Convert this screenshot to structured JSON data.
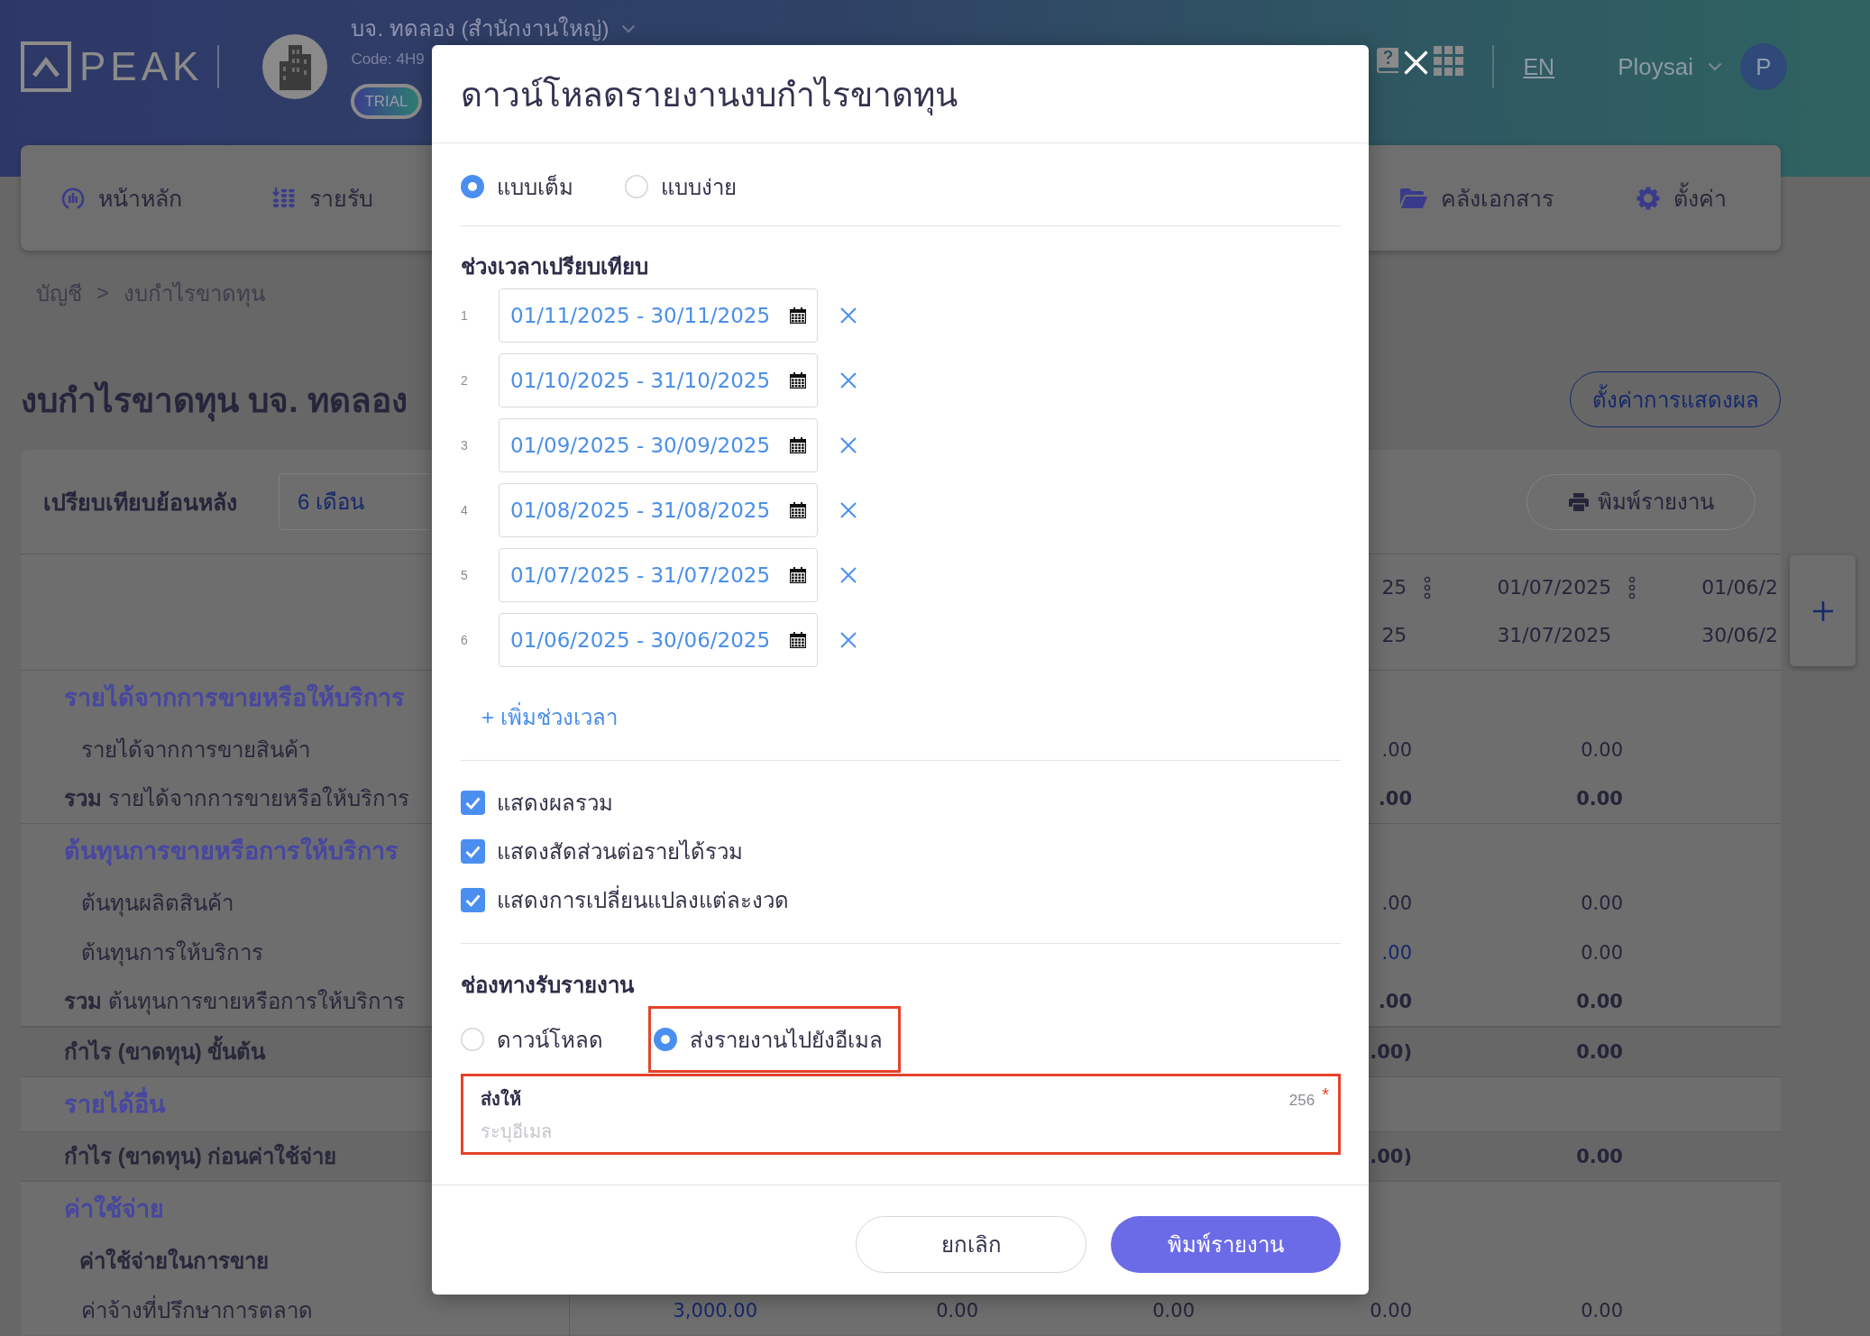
{
  "header": {
    "logo": "PEAK",
    "company": {
      "name": "บจ. ทดลอง (สำนักงานใหญ่)",
      "code": "Code: 4H9",
      "badge": "TRIAL"
    },
    "language": "EN",
    "user": {
      "name": "Ploysai",
      "initial": "P"
    }
  },
  "nav": [
    {
      "kind": "dashboard",
      "label": "หน้าหลัก"
    },
    {
      "kind": "income",
      "label": "รายรับ"
    },
    {
      "kind": "documents",
      "label": "คลังเอกสาร"
    },
    {
      "kind": "settings",
      "label": "ตั้งค่า"
    }
  ],
  "breadcrumb": [
    "บัญชี",
    ">",
    "งบกำไรขาดทุน"
  ],
  "page": {
    "title": "งบกำไรขาดทุน บจ. ทดลอง",
    "display_settings_button": "ตั้งค่าการแสดงผล"
  },
  "report": {
    "compare_label": "เปรียบเทียบย้อนหลัง",
    "period_select": "6 เดือน",
    "print_button": "พิมพ์รายงาน",
    "columns": [
      {
        "start": "25",
        "end": "25",
        "menu": true
      },
      {
        "start": "01/07/2025",
        "end": "31/07/2025",
        "menu": true
      },
      {
        "start": "01/06/2",
        "end": "30/06/2",
        "menu": false
      }
    ],
    "rows": [
      {
        "kind": "section",
        "label": "รายได้จากการขายหรือให้บริการ"
      },
      {
        "kind": "item",
        "label": "รายได้จากการขายสินค้า",
        "values": [
          {
            "text": ".00",
            "link": false
          },
          {
            "text": "0.00",
            "link": false
          }
        ]
      },
      {
        "kind": "total",
        "label": "**รวม** รายได้จากการขายหรือให้บริการ",
        "values": [
          {
            "text": ".00",
            "link": false
          },
          {
            "text": "0.00",
            "link": false
          }
        ]
      },
      {
        "kind": "section",
        "label": "ต้นทุนการขายหรือการให้บริการ"
      },
      {
        "kind": "item",
        "label": "ต้นทุนผลิตสินค้า",
        "values": [
          {
            "text": ".00",
            "link": false
          },
          {
            "text": "0.00",
            "link": false
          }
        ]
      },
      {
        "kind": "item",
        "label": "ต้นทุนการให้บริการ",
        "values": [
          {
            "text": ".00",
            "link": true
          },
          {
            "text": "0.00",
            "link": false
          }
        ]
      },
      {
        "kind": "total",
        "label": "**รวม** ต้นทุนการขายหรือการให้บริการ",
        "values": [
          {
            "text": ".00",
            "link": false
          },
          {
            "text": "0.00",
            "link": false
          }
        ]
      },
      {
        "kind": "band",
        "label": "กำไร (ขาดทุน) ขั้นต้น",
        "values": [
          {
            "text": ".00)",
            "link": false
          },
          {
            "text": "0.00",
            "link": false
          }
        ]
      },
      {
        "kind": "section",
        "label": "รายได้อื่น"
      },
      {
        "kind": "band",
        "label": "กำไร (ขาดทุน) ก่อนค่าใช้จ่าย",
        "values": [
          {
            "text": ".00)",
            "link": false
          },
          {
            "text": "0.00",
            "link": false
          }
        ]
      },
      {
        "kind": "section",
        "label": "ค่าใช้จ่าย"
      },
      {
        "kind": "group",
        "label": "ค่าใช้จ่ายในการขาย"
      },
      {
        "kind": "item",
        "label": "ค่าจ้างที่ปรึกษาการตลาด",
        "values": [
          {
            "text": "3,000.00",
            "link": true
          },
          {
            "text": "0.00",
            "link": false
          },
          {
            "text": "0.00",
            "link": false
          },
          {
            "text": "0.00",
            "link": false
          },
          {
            "text": "0.00",
            "link": false
          }
        ]
      }
    ]
  },
  "modal": {
    "title": "ดาวน์โหลดรายงานงบกำไรขาดทุน",
    "format_options": [
      {
        "label": "แบบเต็ม",
        "selected": true
      },
      {
        "label": "แบบง่าย",
        "selected": false
      }
    ],
    "periods_heading": "ช่วงเวลาเปรียบเทียบ",
    "periods": [
      {
        "number": "1",
        "range": "01/11/2025 - 30/11/2025"
      },
      {
        "number": "2",
        "range": "01/10/2025 - 31/10/2025"
      },
      {
        "number": "3",
        "range": "01/09/2025 - 30/09/2025"
      },
      {
        "number": "4",
        "range": "01/08/2025 - 31/08/2025"
      },
      {
        "number": "5",
        "range": "01/07/2025 - 31/07/2025"
      },
      {
        "number": "6",
        "range": "01/06/2025 - 30/06/2025"
      }
    ],
    "add_period": "+ เพิ่มช่วงเวลา",
    "options": [
      {
        "label": "แสดงผลรวม",
        "checked": true
      },
      {
        "label": "แสดงสัดส่วนต่อรายได้รวม",
        "checked": true
      },
      {
        "label": "แสดงการเปลี่ยนแปลงแต่ละงวด",
        "checked": true
      }
    ],
    "delivery_heading": "ช่องทางรับรายงาน",
    "delivery_options": [
      {
        "label": "ดาวน์โหลด",
        "selected": false,
        "highlighted": false
      },
      {
        "label": "ส่งรายงานไปยังอีเมล",
        "selected": true,
        "highlighted": true
      }
    ],
    "recipient": {
      "label": "ส่งให้",
      "counter": "256",
      "required_mark": "*",
      "placeholder": "ระบุอีเมล",
      "highlighted": true
    },
    "buttons": [
      {
        "kind": "secondary",
        "label": "ยกเลิก"
      },
      {
        "kind": "primary",
        "label": "พิมพ์รายงาน"
      }
    ]
  }
}
